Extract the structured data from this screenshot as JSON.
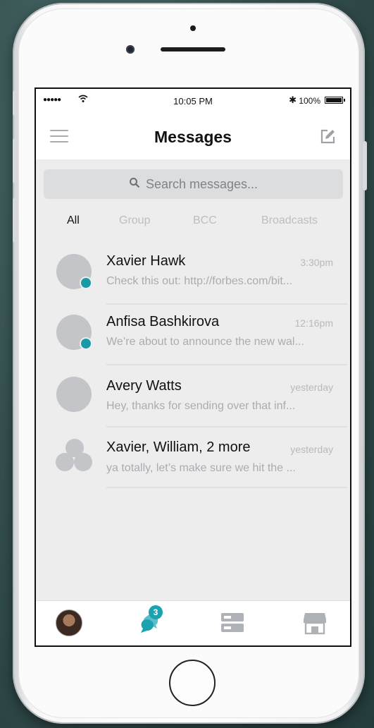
{
  "status_bar": {
    "signal": "●●●●●",
    "time": "10:05 PM",
    "bluetooth": "✱",
    "battery_percent": "100%",
    "battery_level": 1.0
  },
  "header": {
    "title": "Messages",
    "menu_icon": "hamburger-menu-icon",
    "compose_icon": "compose-icon"
  },
  "search": {
    "placeholder": "Search messages...",
    "icon": "search-icon"
  },
  "filters": [
    {
      "label": "All",
      "active": true
    },
    {
      "label": "Group",
      "active": false
    },
    {
      "label": "BCC",
      "active": false
    },
    {
      "label": "Broadcasts",
      "active": false
    }
  ],
  "conversations": [
    {
      "name": "Xavier Hawk",
      "time": "3:30pm",
      "preview": "Check this out: http://forbes.com/bit...",
      "unread": true,
      "group": false
    },
    {
      "name": "Anfisa Bashkirova",
      "time": "12:16pm",
      "preview": "We’re about to announce the new wal...",
      "unread": true,
      "group": false
    },
    {
      "name": "Avery Watts",
      "time": "yesterday",
      "preview": "Hey, thanks for sending over that inf...",
      "unread": false,
      "group": false
    },
    {
      "name": "Xavier, William, 2 more",
      "time": "yesterday",
      "preview": "ya totally, let’s make sure we hit the ...",
      "unread": false,
      "group": true
    }
  ],
  "tab_bar": {
    "messages_badge": "3",
    "accent_color": "#1aa2b0",
    "icons": [
      "profile-avatar",
      "chat-bubbles-icon",
      "server-icon",
      "storefront-icon"
    ]
  },
  "colors": {
    "accent": "#1a9aa8",
    "avatar_placeholder": "#c3c5c9",
    "background": "#ededed"
  }
}
